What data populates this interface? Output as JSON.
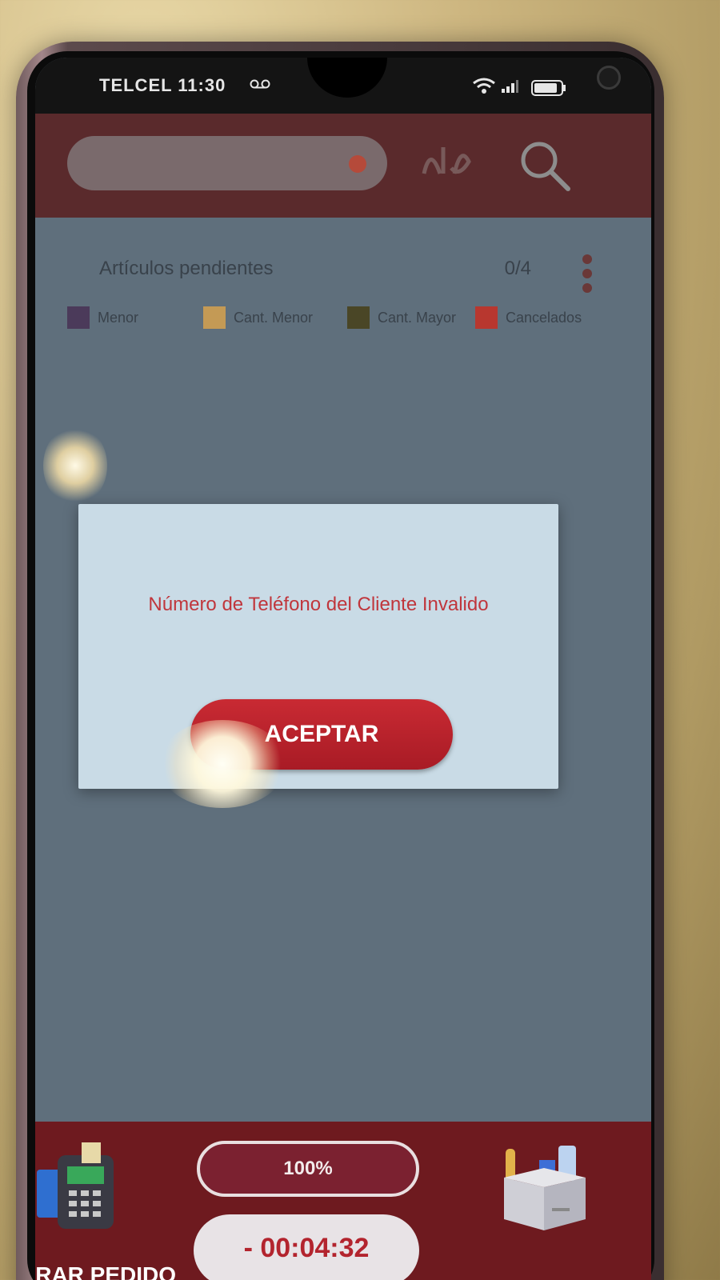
{
  "status_bar": {
    "carrier_time": "TELCEL 11:30"
  },
  "header": {
    "search_placeholder": ""
  },
  "orders": {
    "pending_label": "Artículos pendientes",
    "pending_count": "0/4"
  },
  "legend": [
    {
      "label": "Menor",
      "color": "#4b3a5a"
    },
    {
      "label": "Cant. Menor",
      "color": "#c49a55"
    },
    {
      "label": "Cant. Mayor",
      "color": "#4a4626"
    },
    {
      "label": "Cancelados",
      "color": "#b8372f"
    }
  ],
  "dialog": {
    "message": "Número de Teléfono del Cliente Invalido",
    "accept_label": "ACEPTAR"
  },
  "bottom_bar": {
    "progress": "100%",
    "timer": "- 00:04:32",
    "close_order_label": "RRAR PEDIDO"
  },
  "colors": {
    "brand_red": "#b3242e",
    "dialog_text": "#c0363c",
    "bottom_bar": "#6e1a1f"
  },
  "icons": [
    "voicemail-icon",
    "wifi-icon",
    "signal-icon",
    "battery-icon",
    "search-icon",
    "kebab-menu-icon",
    "pos-terminal-icon",
    "box-icon"
  ]
}
